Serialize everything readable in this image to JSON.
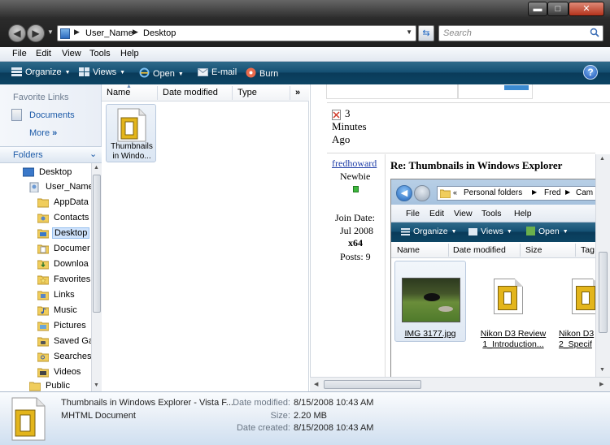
{
  "window": {
    "minimize": "▬",
    "maximize": "□",
    "close": "✕"
  },
  "address": {
    "crumbs": [
      "User_Name",
      "Desktop"
    ],
    "search_placeholder": "Search"
  },
  "menu": [
    "File",
    "Edit",
    "View",
    "Tools",
    "Help"
  ],
  "toolbar": {
    "organize": "Organize",
    "views": "Views",
    "open": "Open",
    "email": "E-mail",
    "burn": "Burn",
    "help": "?"
  },
  "navpane": {
    "favorites_title": "Favorite Links",
    "favorites": [
      "Documents"
    ],
    "more": "More",
    "more_chevron": "»",
    "folders_label": "Folders",
    "tree": [
      {
        "label": "Desktop",
        "icon": "desktop-folder-icon"
      },
      {
        "label": "User_Name",
        "icon": "user-folder-icon"
      },
      {
        "label": "AppData",
        "icon": "folder-icon"
      },
      {
        "label": "Contacts",
        "icon": "contacts-folder-icon"
      },
      {
        "label": "Desktop",
        "icon": "desktop-folder-icon",
        "selected": true
      },
      {
        "label": "Documer",
        "icon": "documents-folder-icon"
      },
      {
        "label": "Downloa",
        "icon": "downloads-folder-icon"
      },
      {
        "label": "Favorites",
        "icon": "favorites-folder-icon"
      },
      {
        "label": "Links",
        "icon": "links-folder-icon"
      },
      {
        "label": "Music",
        "icon": "music-folder-icon"
      },
      {
        "label": "Pictures",
        "icon": "pictures-folder-icon"
      },
      {
        "label": "Saved Ga",
        "icon": "saved-games-folder-icon"
      },
      {
        "label": "Searches",
        "icon": "searches-folder-icon"
      },
      {
        "label": "Videos",
        "icon": "videos-folder-icon"
      },
      {
        "label": "Public",
        "icon": "folder-icon"
      }
    ]
  },
  "filelist": {
    "columns": [
      "Name",
      "Date modified",
      "Type"
    ],
    "more_cols": "»",
    "items": [
      {
        "name": "Thumbnails in Windo...",
        "icon": "mhtml-file-icon"
      }
    ]
  },
  "preview": {
    "time_value": "3",
    "time_unit": "Minutes",
    "time_ago": "Ago",
    "user": "fredhoward",
    "rank": "Newbie",
    "join_label": "Join Date:",
    "join_date": "Jul 2008",
    "arch": "x64",
    "posts": "Posts: 9",
    "post_title": "Re: Thumbnails in Windows Explorer",
    "shot": {
      "breadcrumb": [
        "Personal folders",
        "Fred",
        "Cam"
      ],
      "menu": [
        "File",
        "Edit",
        "View",
        "Tools",
        "Help"
      ],
      "toolbar": [
        "Organize",
        "Views",
        "Open"
      ],
      "columns": [
        "Name",
        "Date modified",
        "Size",
        "Tag"
      ],
      "items": [
        {
          "caption": "IMG 3177.jpg"
        },
        {
          "caption": "Nikon D3 Review 1_Introduction..."
        },
        {
          "caption": "Nikon D3 2_Specif"
        }
      ]
    }
  },
  "details": {
    "name": "Thumbnails in Windows Explorer - Vista F...",
    "type": "MHTML Document",
    "date_modified_label": "Date modified:",
    "date_modified": "8/15/2008 10:43 AM",
    "size_label": "Size:",
    "size": "2.20 MB",
    "date_created_label": "Date created:",
    "date_created": "8/15/2008 10:43 AM"
  },
  "colors": {
    "accent": "#1d5ba8",
    "toolbar": "#155174",
    "selection": "#cfe3fc"
  }
}
